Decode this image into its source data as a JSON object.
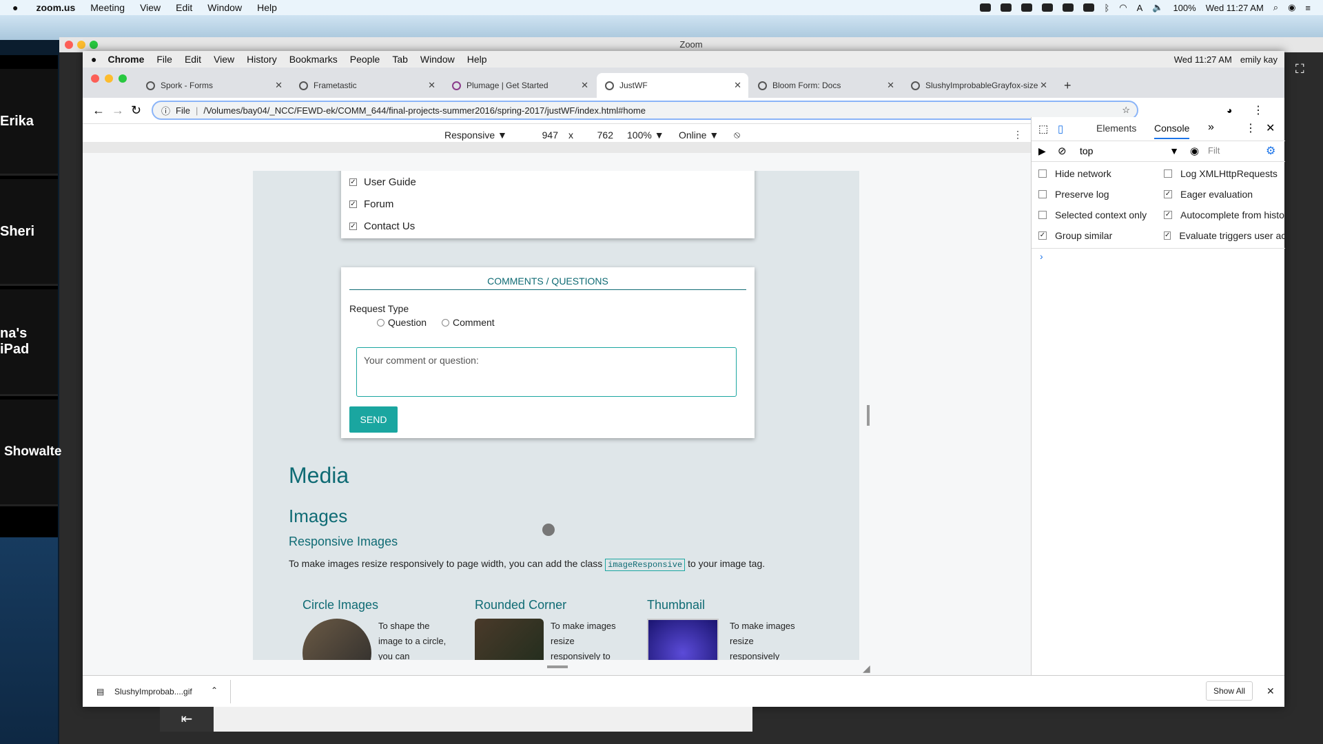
{
  "menubar": {
    "app": "zoom.us",
    "items": [
      "Meeting",
      "View",
      "Edit",
      "Window",
      "Help"
    ],
    "battery": "100%",
    "clock": "Wed 11:27 AM"
  },
  "zoom": {
    "title": "Zoom",
    "participants": [
      "Erika",
      "Sheri",
      "na's iPad",
      "Showalte"
    ],
    "bottom_btn": "⇤"
  },
  "chrome_menu": {
    "app": "Chrome",
    "items": [
      "File",
      "Edit",
      "View",
      "History",
      "Bookmarks",
      "People",
      "Tab",
      "Window",
      "Help"
    ],
    "clock": "Wed 11:27 AM",
    "user": "emily kay"
  },
  "tabs": [
    {
      "label": "Spork - Forms"
    },
    {
      "label": "Frametastic"
    },
    {
      "label": "Plumage | Get Started"
    },
    {
      "label": "JustWF"
    },
    {
      "label": "Bloom Form: Docs"
    },
    {
      "label": "SlushyImprobableGrayfox-size"
    }
  ],
  "new_tab": "+",
  "address": {
    "scheme": "File",
    "url": "/Volumes/bay04/_NCC/FEWD-ek/COMM_644/final-projects-summer2016/spring-2017/justWF/index.html#home"
  },
  "device": {
    "mode": "Responsive ▼",
    "width": "947",
    "x": "x",
    "height": "762",
    "zoom": "100% ▼",
    "network": "Online ▼"
  },
  "page": {
    "checks": [
      "User Guide",
      "Forum",
      "Contact Us"
    ],
    "comments_title": "COMMENTS / QUESTIONS",
    "request_type": "Request Type",
    "radio_question": "Question",
    "radio_comment": "Comment",
    "textarea_placeholder": "Your comment or question:",
    "send": "SEND",
    "media": "Media",
    "images": "Images",
    "responsive_images": "Responsive Images",
    "resp_text_1": "To make images resize responsively to page width, you can add the class",
    "resp_code": "imageResponsive",
    "resp_text_2": "to your image tag.",
    "cols": [
      {
        "title": "Circle Images",
        "text": "To shape the image to a circle, you can"
      },
      {
        "title": "Rounded Corner",
        "text": "To make images resize responsively to"
      },
      {
        "title": "Thumbnail",
        "text": "To make images resize responsively"
      }
    ]
  },
  "devtools": {
    "tabs": [
      "Elements",
      "Console"
    ],
    "more": "»",
    "context": "top",
    "filter": "Filt",
    "opts_left": [
      {
        "label": "Hide network",
        "checked": false
      },
      {
        "label": "Preserve log",
        "checked": false
      },
      {
        "label": "Selected context only",
        "checked": false
      },
      {
        "label": "Group similar",
        "checked": true
      }
    ],
    "opts_right": [
      {
        "label": "Log XMLHttpRequests",
        "checked": false
      },
      {
        "label": "Eager evaluation",
        "checked": true
      },
      {
        "label": "Autocomplete from histo",
        "checked": true
      },
      {
        "label": "Evaluate triggers user ac",
        "checked": true
      }
    ],
    "prompt": "›"
  },
  "download": {
    "file": "SlushyImprobab....gif",
    "show_all": "Show All"
  },
  "colors": {
    "teal": "#0f6b74",
    "send": "#1aa6a0"
  }
}
